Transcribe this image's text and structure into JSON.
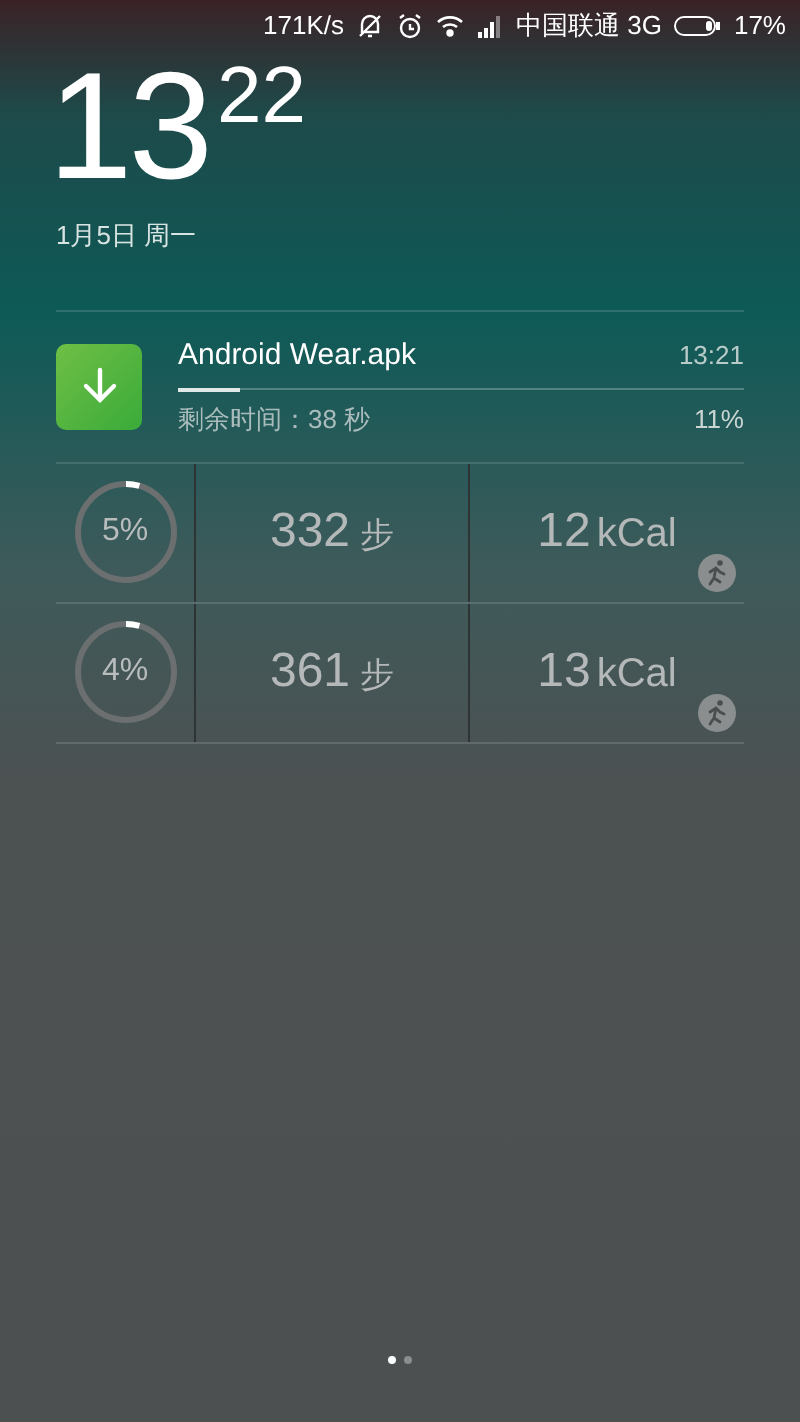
{
  "status_bar": {
    "speed": "171K/s",
    "carrier": "中国联通 3G",
    "battery": "17%"
  },
  "clock": {
    "hour": "13",
    "minute": "22",
    "date": "1月5日 周一"
  },
  "download": {
    "title": "Android Wear.apk",
    "time": "13:21",
    "level": 0.11,
    "remaining": "剩余时间：38 秒",
    "percent": "11%"
  },
  "fitness": [
    {
      "percent": "5%",
      "steps": "332",
      "steps_unit": "步",
      "calories": "12",
      "calories_unit": "kCal"
    },
    {
      "percent": "4%",
      "steps": "361",
      "steps_unit": "步",
      "calories": "13",
      "calories_unit": "kCal"
    }
  ],
  "pages": [
    {
      "selected": true
    },
    {
      "selected": false
    }
  ]
}
